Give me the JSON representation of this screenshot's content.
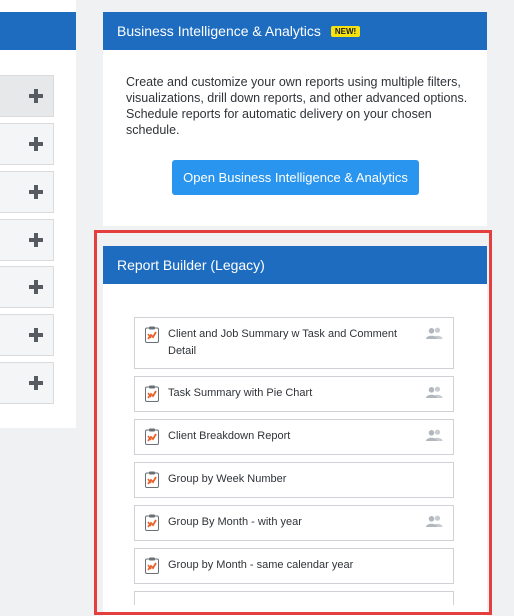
{
  "bi": {
    "title": "Business Intelligence & Analytics",
    "badge": "NEW!",
    "description": "Create and customize your own reports using multiple filters, visualizations, drill down reports, and other advanced options. Schedule reports for automatic delivery on your chosen schedule.",
    "button_label": "Open Business Intelligence & Analytics"
  },
  "report_builder": {
    "title": "Report Builder (Legacy)",
    "reports": [
      {
        "label": "Client and Job Summary w Task and Comment Detail",
        "shared": true
      },
      {
        "label": "Task Summary with Pie Chart",
        "shared": true
      },
      {
        "label": "Client Breakdown Report",
        "shared": true
      },
      {
        "label": "Group by Week Number",
        "shared": false
      },
      {
        "label": "Group By Month - with year",
        "shared": true
      },
      {
        "label": "Group by Month - same calendar year",
        "shared": false
      }
    ]
  },
  "icons": {
    "report": "clipboard-chart-icon",
    "shared": "users-icon",
    "expand": "plus-icon"
  },
  "colors": {
    "header_blue": "#1d6cc0",
    "button_blue": "#2a95ef",
    "badge_yellow": "#f5e20e",
    "highlight_red": "#e53e3e",
    "icon_orange": "#e8622c"
  }
}
